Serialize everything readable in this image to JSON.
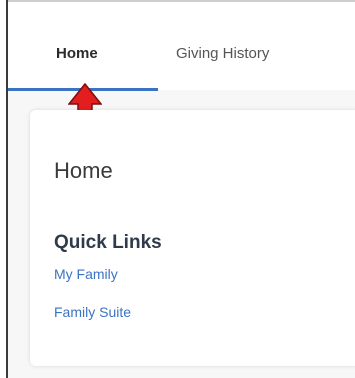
{
  "tabs": [
    {
      "label": "Home"
    },
    {
      "label": "Giving History"
    }
  ],
  "colors": {
    "accent": "#3b73c4",
    "arrow": "#e41e1e"
  },
  "icons": {
    "annotation_arrow": "up-arrow-icon"
  },
  "card": {
    "title": "Home",
    "quick_links": {
      "title": "Quick Links",
      "items": [
        {
          "label": "My Family"
        },
        {
          "label": "Family Suite"
        }
      ]
    }
  }
}
